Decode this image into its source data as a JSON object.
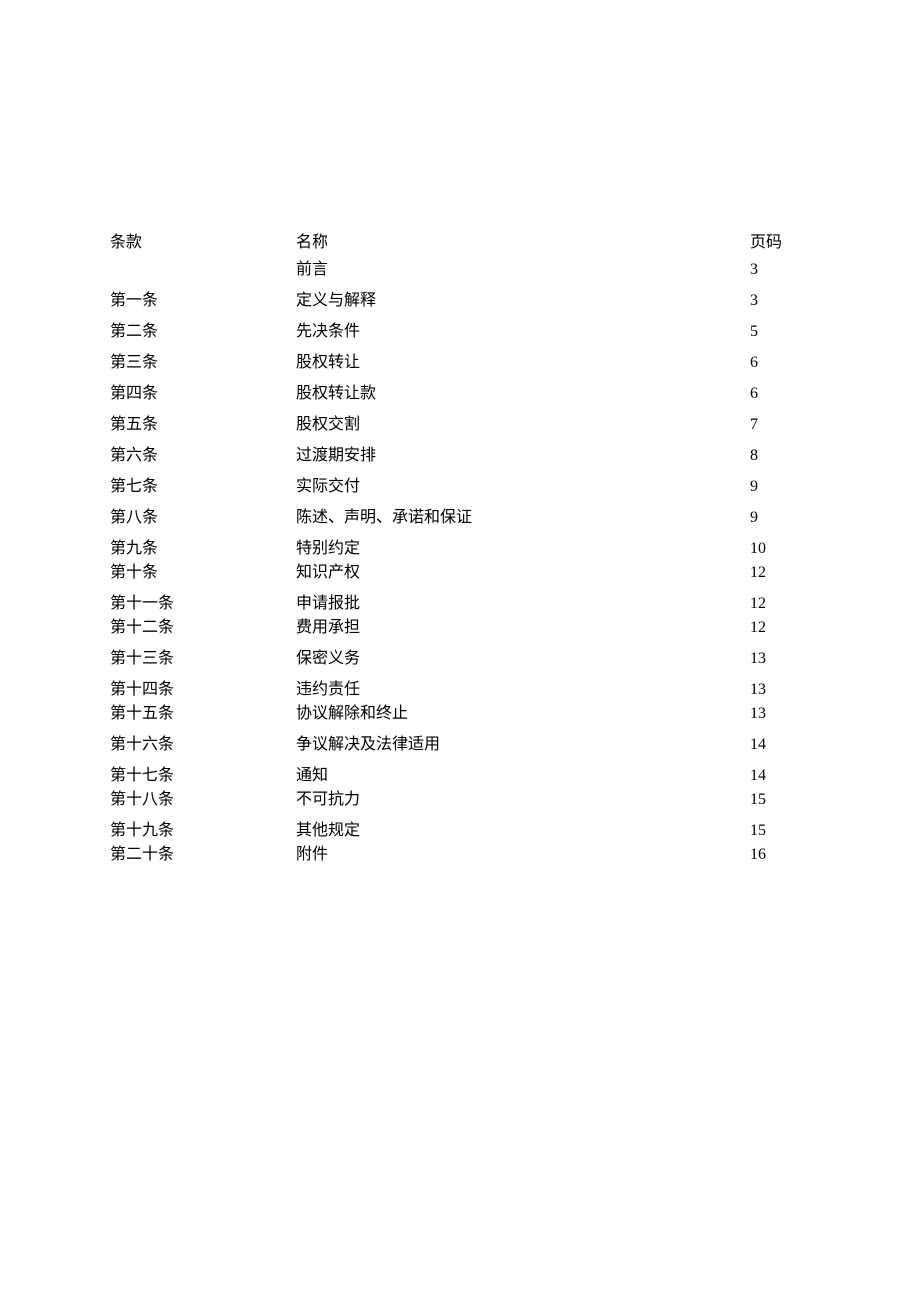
{
  "headers": {
    "article": "条款",
    "name": "名称",
    "page": "页码"
  },
  "rows": [
    {
      "article": "",
      "name": "前言",
      "page": "3",
      "group": 0
    },
    {
      "article": "第一条",
      "name": "定义与解释",
      "page": "3",
      "group": 1
    },
    {
      "article": "第二条",
      "name": "先决条件",
      "page": "5",
      "group": 2
    },
    {
      "article": "第三条",
      "name": "股权转让",
      "page": "6",
      "group": 3
    },
    {
      "article": "第四条",
      "name": "股权转让款",
      "page": "6",
      "group": 4
    },
    {
      "article": "第五条",
      "name": "股权交割",
      "page": "7",
      "group": 5
    },
    {
      "article": "第六条",
      "name": "过渡期安排",
      "page": "8",
      "group": 6
    },
    {
      "article": "第七条",
      "name": "实际交付",
      "page": "9",
      "group": 7
    },
    {
      "article": "第八条",
      "name": "陈述、声明、承诺和保证",
      "page": "9",
      "group": 8
    },
    {
      "article": "第九条",
      "name": "特别约定",
      "page": "10",
      "group": 9
    },
    {
      "article": "第十条",
      "name": "知识产权",
      "page": "12",
      "group": 9
    },
    {
      "article": "第十一条",
      "name": "申请报批",
      "page": "12",
      "group": 10
    },
    {
      "article": "第十二条",
      "name": "费用承担",
      "page": "12",
      "group": 10
    },
    {
      "article": "第十三条",
      "name": "保密义务",
      "page": "13",
      "group": 11
    },
    {
      "article": "第十四条",
      "name": "违约责任",
      "page": "13",
      "group": 12
    },
    {
      "article": "第十五条",
      "name": "协议解除和终止",
      "page": "13",
      "group": 12
    },
    {
      "article": "第十六条",
      "name": "争议解决及法律适用",
      "page": "14",
      "group": 13
    },
    {
      "article": "第十七条",
      "name": "通知",
      "page": "14",
      "group": 14
    },
    {
      "article": "第十八条",
      "name": "不可抗力",
      "page": "15",
      "group": 14
    },
    {
      "article": "第十九条",
      "name": "其他规定",
      "page": "15",
      "group": 15
    },
    {
      "article": "第二十条",
      "name": "附件",
      "page": "16",
      "group": 15
    }
  ]
}
